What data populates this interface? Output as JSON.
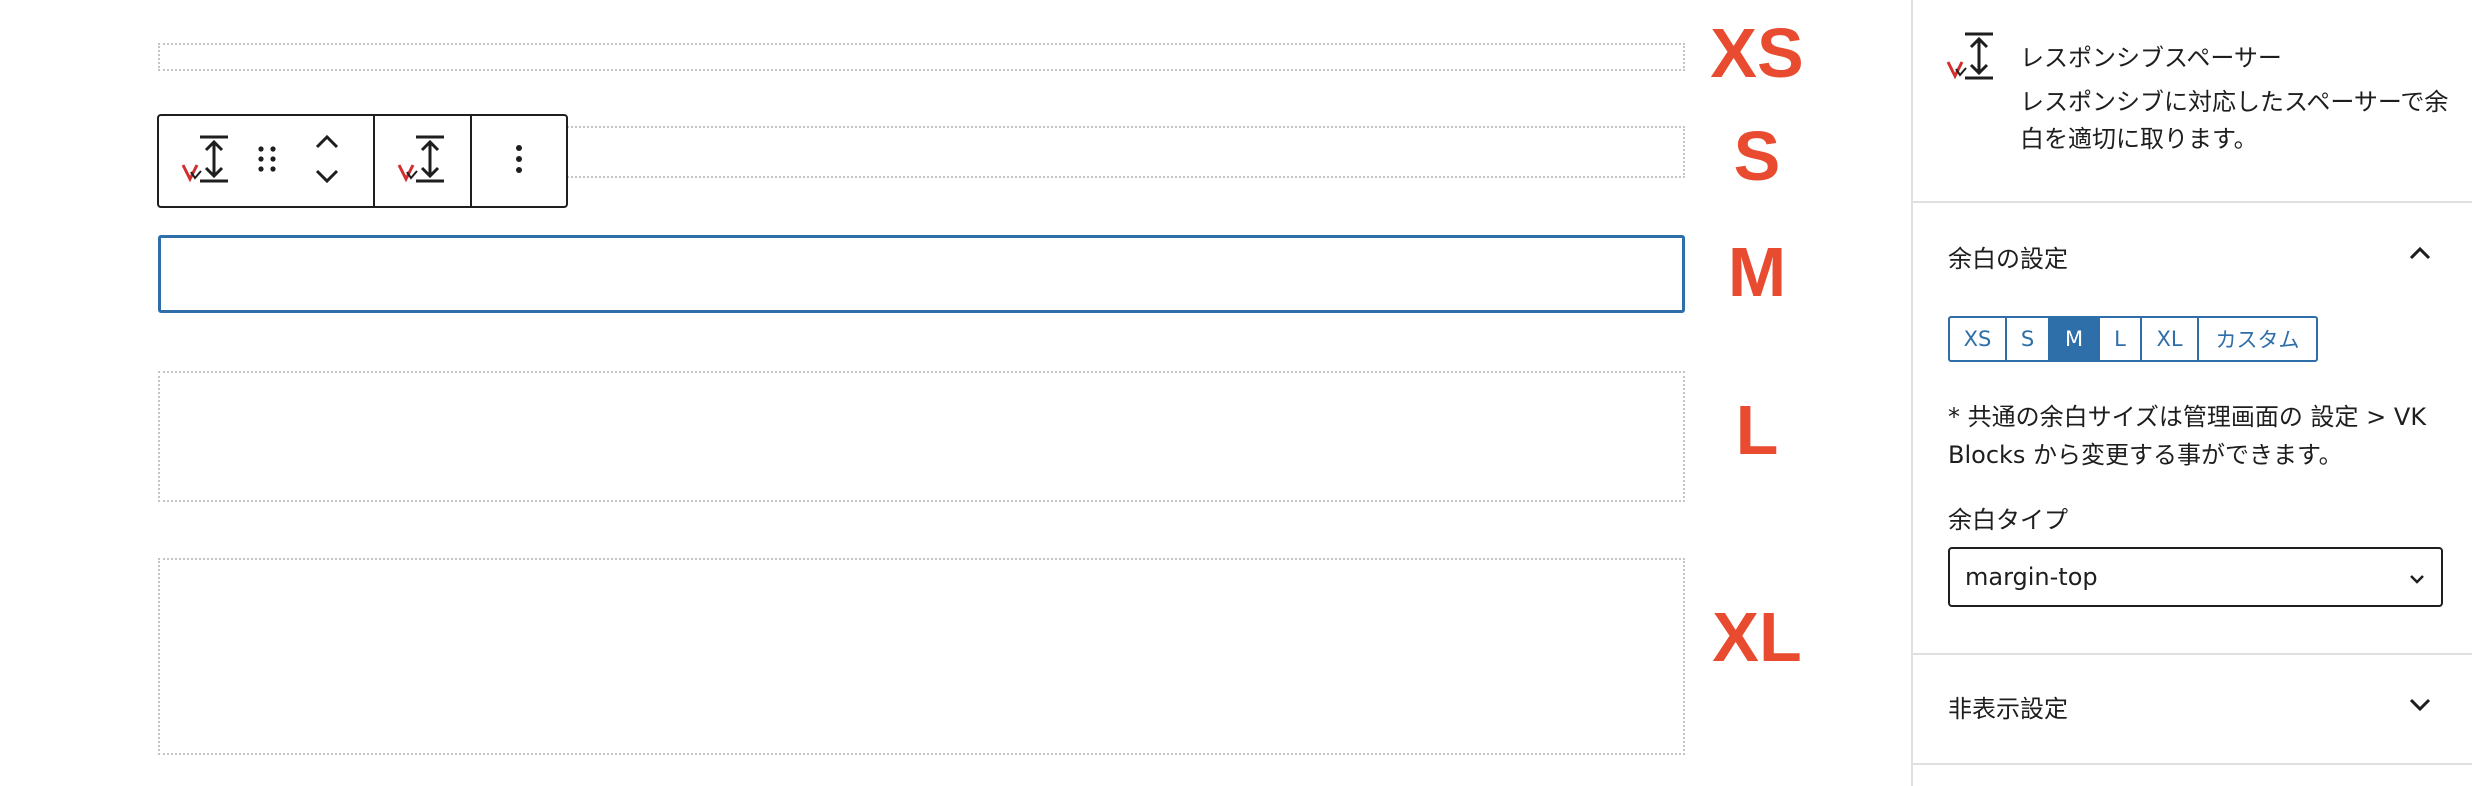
{
  "size_labels": {
    "xs": "XS",
    "s": "S",
    "m": "M",
    "l": "L",
    "xl": "XL"
  },
  "colors": {
    "accent": "#2e6ea9",
    "annotation": "#e84b2f",
    "border": "#1e1e1e",
    "dotted": "#c4c4c4"
  },
  "toolbar": {
    "icons": [
      "vk-spacer-icon",
      "drag-handle-icon",
      "move-up-icon",
      "move-down-icon",
      "vk-spacer-icon",
      "more-options-icon"
    ]
  },
  "sidebar": {
    "block": {
      "title": "レスポンシブスペーサー",
      "description": "レスポンシブに対応したスペーサーで余白を適切に取ります。"
    },
    "spacing_panel": {
      "title": "余白の設定",
      "sizes": [
        "XS",
        "S",
        "M",
        "L",
        "XL",
        "カスタム"
      ],
      "selected": "M",
      "note": "* 共通の余白サイズは管理画面の 設定 > VK Blocks から変更する事ができます。",
      "type_label": "余白タイプ",
      "type_value": "margin-top"
    },
    "hide_panel": {
      "title": "非表示設定"
    }
  }
}
